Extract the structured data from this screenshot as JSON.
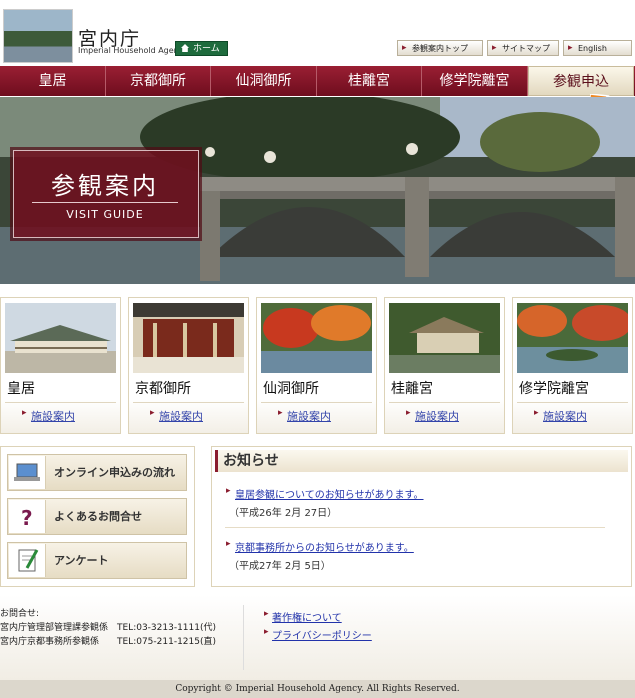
{
  "header": {
    "title": "宮内庁",
    "subtitle": "Imperial Household Agency",
    "home_label": "ホーム",
    "util_links": [
      "参観案内トップ",
      "サイトマップ",
      "English"
    ]
  },
  "nav": {
    "items": [
      "皇居",
      "京都御所",
      "仙洞御所",
      "桂離宮",
      "修学院離宮",
      "参観申込"
    ],
    "active_index": 5
  },
  "hero": {
    "title": "参観案内",
    "subtitle": "VISIT GUIDE"
  },
  "facilities": [
    {
      "name": "皇居",
      "link": "施設案内"
    },
    {
      "name": "京都御所",
      "link": "施設案内"
    },
    {
      "name": "仙洞御所",
      "link": "施設案内"
    },
    {
      "name": "桂離宮",
      "link": "施設案内"
    },
    {
      "name": "修学院離宮",
      "link": "施設案内"
    }
  ],
  "side_buttons": [
    {
      "label": "オンライン申込みの流れ",
      "icon": "laptop-icon"
    },
    {
      "label": "よくあるお問合せ",
      "icon": "question-icon"
    },
    {
      "label": "アンケート",
      "icon": "survey-icon"
    }
  ],
  "news": {
    "title": "お知らせ",
    "items": [
      {
        "text": "皇居参観についてのお知らせがあります。",
        "date": "（平成26年 2月 27日）"
      },
      {
        "text": "京都事務所からのお知らせがあります。",
        "date": "（平成27年 2月 5日）"
      }
    ]
  },
  "footer": {
    "contact_heading": "お問合せ:",
    "contacts": [
      "宮内庁管理部管理課参観係　TEL:03-3213-1111(代)",
      "宮内庁京都事務所参観係　　TEL:075-211-1215(直)"
    ],
    "links": [
      "著作権について",
      "プライバシーポリシー"
    ],
    "copyright": "Copyright © Imperial Household Agency. All Rights Reserved."
  },
  "colors": {
    "brand_maroon": "#7a1226",
    "home_green": "#1e6b3d",
    "arrow_orange": "#f08a24"
  }
}
